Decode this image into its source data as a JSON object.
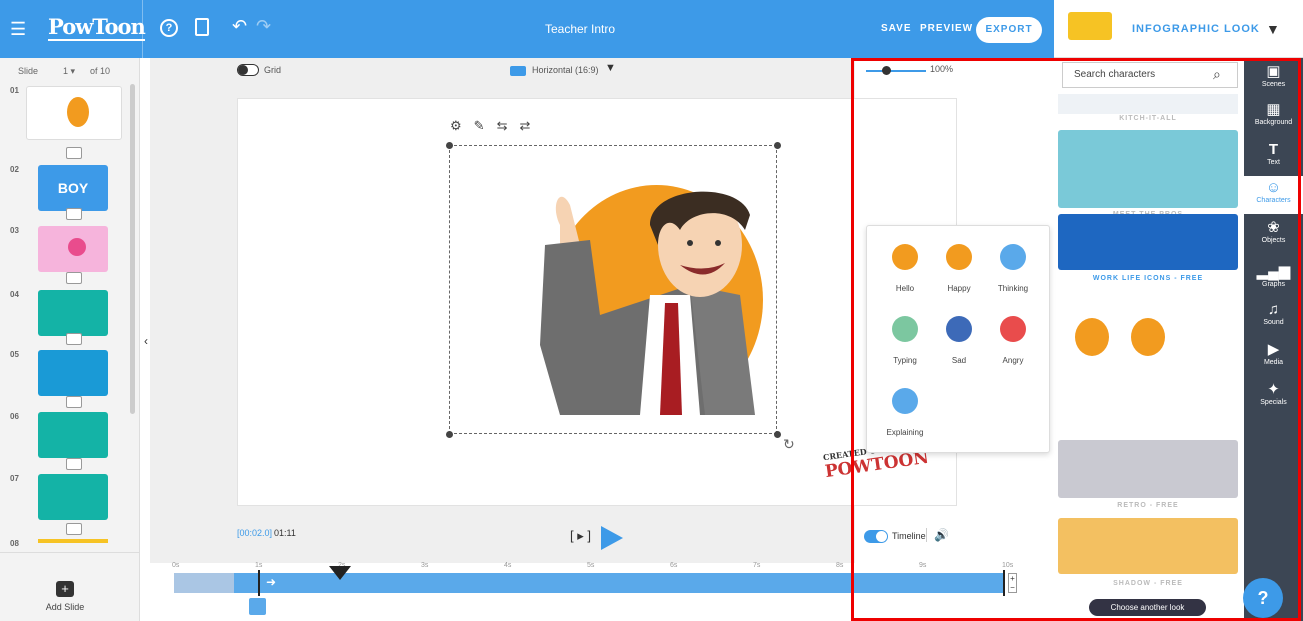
{
  "topbar": {
    "logo": "PowToon",
    "title": "Teacher Intro",
    "save_label": "SAVE",
    "preview_label": "PREVIEW",
    "export_label": "EXPORT",
    "look_label": "INFOGRAPHIC LOOK"
  },
  "slides": {
    "slide_label": "Slide",
    "current": "1",
    "of_label": "of 10",
    "numbers": [
      "01",
      "02",
      "03",
      "04",
      "05",
      "06",
      "07",
      "08"
    ],
    "add_slide_label": "Add Slide",
    "thumb_texts": [
      "",
      "BOY",
      "",
      "",
      "",
      "",
      "",
      ""
    ]
  },
  "canvas": {
    "grid_label": "Grid",
    "orientation_label": "Horizontal (16:9)",
    "zoom_label": "100%",
    "watermark": "POWTOON",
    "watermark_created": "CREATED USING"
  },
  "timeline": {
    "timecode": "[00:02.0]",
    "total": "01:11",
    "bracket_play": "[ ▸ ]",
    "toggle_label": "Timeline",
    "ticks": [
      "0s",
      "1s",
      "2s",
      "3s",
      "4s",
      "5s",
      "6s",
      "7s",
      "8s",
      "9s",
      "10s"
    ]
  },
  "popup": {
    "items": [
      "Hello",
      "Happy",
      "Thinking",
      "Typing",
      "Sad",
      "Angry",
      "Explaining"
    ]
  },
  "characters": {
    "search_placeholder": "Search characters",
    "looks": [
      "KITCH-IT-ALL",
      "MEET THE PROS",
      "WORK LIFE ICONS - FREE",
      "RETRO - FREE",
      "SHADOW - FREE"
    ],
    "choose_label": "Choose another look"
  },
  "rail": {
    "items": [
      "Scenes",
      "Background",
      "Text",
      "Characters",
      "Objects",
      "Graphs",
      "Sound",
      "Media",
      "Specials"
    ]
  },
  "colors": {
    "accent": "#3d9ae8",
    "rail": "#3c4654",
    "highlight_frame": "#ee0000",
    "orange": "#f29b1f"
  }
}
